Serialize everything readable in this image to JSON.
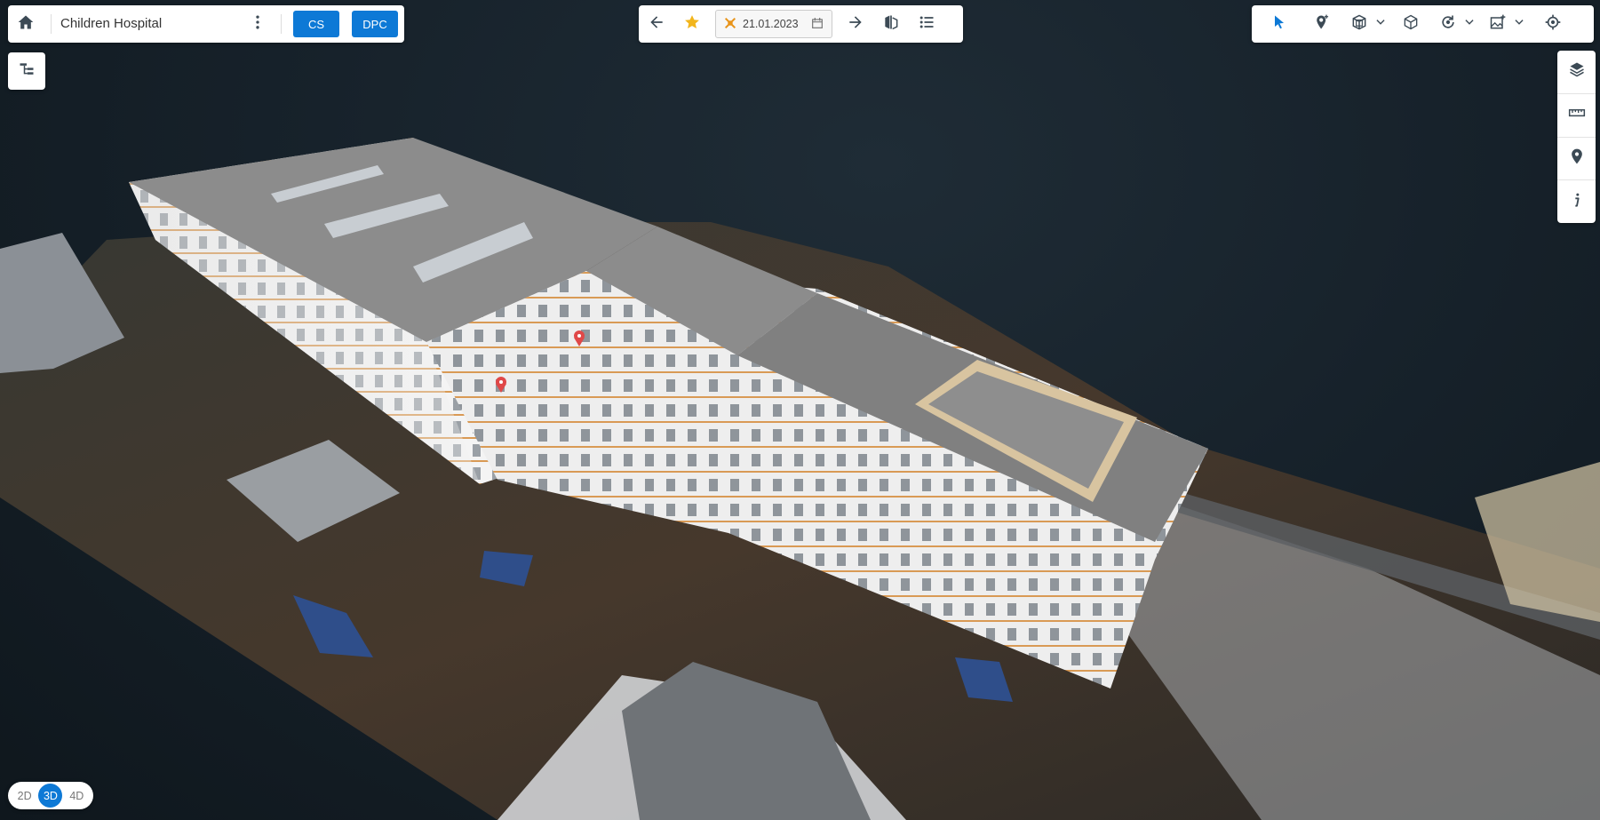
{
  "header": {
    "home_icon": "home-icon",
    "project_title": "Children Hospital",
    "more_icon": "kebab-menu-icon",
    "cs_label": "CS",
    "dpc_label": "DPC"
  },
  "timeline": {
    "back_icon": "arrow-left-icon",
    "favorite_icon": "star-icon",
    "capture_icon": "drone-icon",
    "date_value": "21.01.2023",
    "calendar_icon": "calendar-icon",
    "forward_icon": "arrow-right-icon",
    "compare_icon": "compare-icon",
    "list_icon": "list-icon"
  },
  "toolbar": {
    "select_icon": "cursor-icon",
    "add_pin_icon": "add-pin-icon",
    "section_box_icon": "section-box-icon",
    "cube_icon": "cube-icon",
    "rotate_icon": "rotate-icon",
    "add_image_icon": "add-image-icon",
    "locate_icon": "target-icon"
  },
  "right_bar": [
    "layers-icon",
    "ruler-icon",
    "location-pin-icon",
    "info-icon"
  ],
  "view_modes": {
    "items": [
      "2D",
      "3D",
      "4D"
    ],
    "active": "3D"
  },
  "colors": {
    "accent": "#0d79d6",
    "pin": "#e04848"
  }
}
